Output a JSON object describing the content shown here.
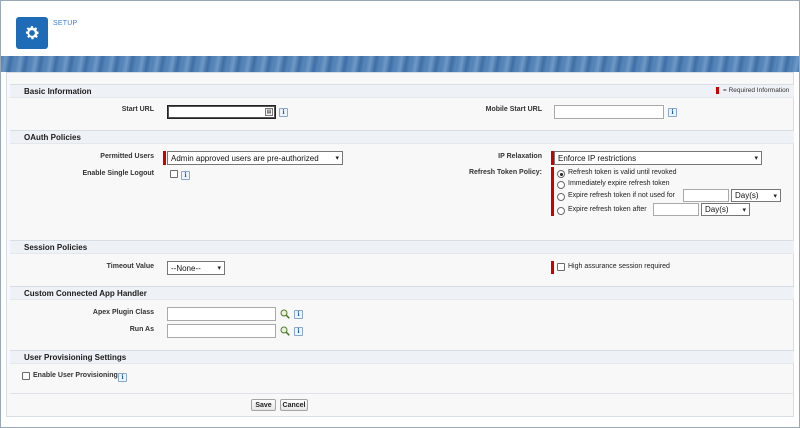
{
  "header": {
    "title": "SETUP",
    "icon": "gear-icon"
  },
  "legend": {
    "required_text": "= Required Information"
  },
  "sections": {
    "basic": "Basic Information",
    "oauth": "OAuth Policies",
    "session": "Session Policies",
    "handler": "Custom Connected App Handler",
    "provisioning": "User Provisioning Settings"
  },
  "basic": {
    "start_url_label": "Start URL",
    "start_url_value": "",
    "mobile_start_url_label": "Mobile Start URL",
    "mobile_start_url_value": ""
  },
  "oauth": {
    "permitted_users_label": "Permitted Users",
    "permitted_users_value": "Admin approved users are pre-authorized",
    "enable_single_logout_label": "Enable Single Logout",
    "ip_relaxation_label": "IP Relaxation",
    "ip_relaxation_value": "Enforce IP restrictions",
    "refresh_token_policy_label": "Refresh Token Policy:",
    "refresh_options": [
      "Refresh token is valid until revoked",
      "Immediately expire refresh token",
      "Expire refresh token if not used for",
      "Expire refresh token after"
    ],
    "refresh_selected": 0,
    "unused_unit": "Day(s)",
    "after_unit": "Day(s)"
  },
  "session": {
    "timeout_label": "Timeout Value",
    "timeout_value": "--None--",
    "high_assurance_label": "High assurance session required"
  },
  "handler": {
    "apex_plugin_label": "Apex Plugin Class",
    "run_as_label": "Run As"
  },
  "provisioning": {
    "enable_label": "Enable User Provisioning"
  },
  "buttons": {
    "save": "Save",
    "cancel": "Cancel"
  },
  "colors": {
    "accent": "#1e6cb8",
    "required": "#cc0000",
    "banner": "#4f7fb3"
  }
}
